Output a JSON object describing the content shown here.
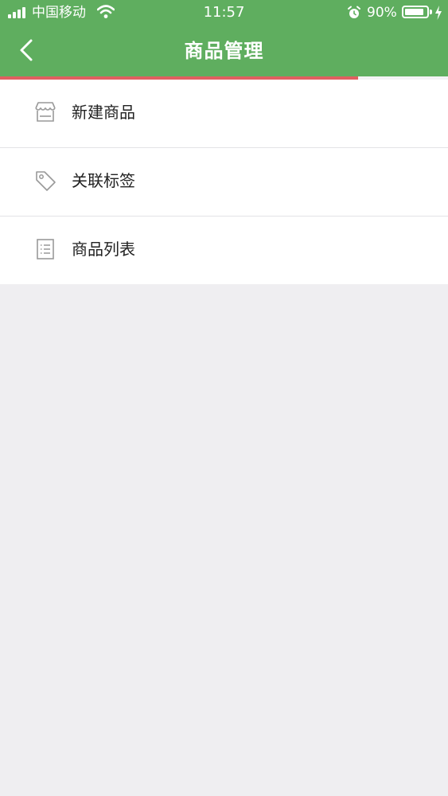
{
  "status_bar": {
    "carrier": "中国移动",
    "time": "11:57",
    "battery_percent": "90%",
    "battery_level": 0.9,
    "icons": [
      "signal-icon",
      "wifi-icon",
      "alarm-icon",
      "battery-icon",
      "charging-icon"
    ]
  },
  "nav": {
    "title": "商品管理",
    "back_icon": "chevron-left-icon"
  },
  "load_progress": 0.8,
  "colors": {
    "header_bg": "#5fae5f",
    "progress": "#e06060",
    "page_bg": "#efeef1"
  },
  "menu": [
    {
      "label": "新建商品",
      "icon": "store-icon"
    },
    {
      "label": "关联标签",
      "icon": "tag-icon"
    },
    {
      "label": "商品列表",
      "icon": "list-icon"
    }
  ]
}
